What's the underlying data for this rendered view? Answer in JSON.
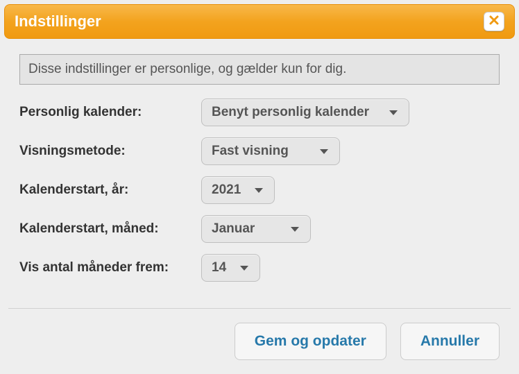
{
  "dialog": {
    "title": "Indstillinger",
    "info": "Disse indstillinger er personlige, og gælder kun for dig."
  },
  "fields": {
    "personal_calendar": {
      "label": "Personlig kalender:",
      "value": "Benyt personlig kalender"
    },
    "display_method": {
      "label": "Visningsmetode:",
      "value": "Fast visning"
    },
    "start_year": {
      "label": "Kalenderstart, år:",
      "value": "2021"
    },
    "start_month": {
      "label": "Kalenderstart, måned:",
      "value": "Januar"
    },
    "months_ahead": {
      "label": "Vis antal måneder frem:",
      "value": "14"
    }
  },
  "buttons": {
    "save": "Gem og opdater",
    "cancel": "Annuller"
  }
}
